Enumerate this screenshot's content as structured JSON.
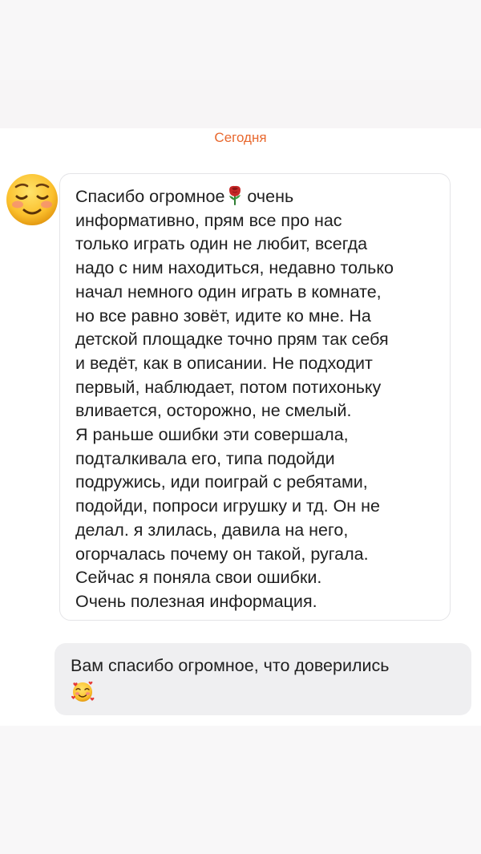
{
  "chat": {
    "date_separator": "Сегодня",
    "incoming": {
      "lines": [
        "Спасибо огромное",
        "очень",
        "информативно, прям все про нас",
        "только играть один не любит, всегда",
        "надо с ним находиться, недавно только",
        "начал немного один играть в комнате,",
        "но все равно зовёт, идите ко мне. На",
        "детской площадке точно прям так себя",
        "и ведёт, как в описании. Не подходит",
        "первый, наблюдает, потом потихоньку",
        "вливается, осторожно, не смелый.",
        "Я раньше ошибки эти совершала,",
        "подталкивала его, типа подойди",
        "подружись, иди поиграй с ребятами,",
        "подойди, попроси игрушку и тд. Он не",
        "делал. я злилась, давила на него,",
        "огорчалась почему он такой, ругала.",
        "Сейчас я поняла свои ошибки.",
        "Очень полезная информация."
      ],
      "avatar_emoji": "smiling-face-icon",
      "inline_emoji": "rose-icon"
    },
    "outgoing": {
      "text": "Вам спасибо огромное, что доверились",
      "emoji": "smiling-face-with-hearts-icon"
    }
  },
  "colors": {
    "accent": "#e8682e",
    "incoming_border": "#e4e4e7",
    "outgoing_bg": "#efeff1",
    "band_bg": "#f8f7f8",
    "text": "#202020"
  }
}
